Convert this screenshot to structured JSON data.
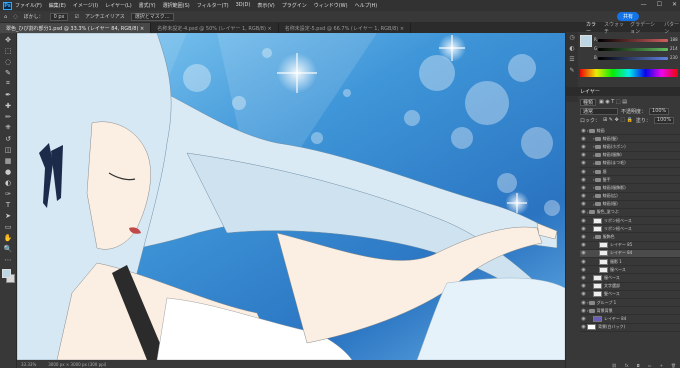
{
  "app": {
    "logo": "Ps",
    "share_label": "共有"
  },
  "menu": [
    "ファイル(F)",
    "編集(E)",
    "イメージ(I)",
    "レイヤー(L)",
    "書式(Y)",
    "選択範囲(S)",
    "フィルター(T)",
    "3D(D)",
    "表示(V)",
    "プラグイン",
    "ウィンドウ(W)",
    "ヘルプ(H)"
  ],
  "window_controls": [
    "—",
    "☐",
    "✕"
  ],
  "options": {
    "blur_label": "ぼかし：",
    "blur_value": "0 px",
    "antialias_label": "アンチエイリアス",
    "select_mask_label": "選択とマスク..."
  },
  "tabs": [
    {
      "label": "翠色_ひび割れ部分1.psd @ 33.3% (レイヤー 84, RGB/8) ×",
      "active": true
    },
    {
      "label": "名称未設定-4.psd @ 50% (レイヤー 1, RGB/8) ×",
      "active": false
    },
    {
      "label": "名称未設定-5.psd @ 66.7% (レイヤー 1, RGB/8) ×",
      "active": false
    }
  ],
  "status": {
    "zoom": "33.33%",
    "doc_size": "3000 px × 3000 px (300 ppi)"
  },
  "color_panel": {
    "tabs": [
      "カラー",
      "スウォッチ",
      "グラデーション",
      "パターン"
    ],
    "sliders": [
      {
        "label": "R",
        "value": "188",
        "color": "#d06060"
      },
      {
        "label": "G",
        "value": "214",
        "color": "#60c060"
      },
      {
        "label": "B",
        "value": "230",
        "color": "#6080e0"
      }
    ],
    "fg_color": "#bcd6e6"
  },
  "layers_panel": {
    "title": "レイヤー",
    "filter": "種類",
    "blend_mode": "通常",
    "opacity_label": "不透明度：",
    "opacity": "100%",
    "lock_label": "ロック：",
    "fill_label": "塗り：",
    "fill": "100%",
    "layers": [
      {
        "name": "線画",
        "kind": "folder",
        "indent": 0
      },
      {
        "name": "線画(髪)",
        "kind": "folder",
        "indent": 1
      },
      {
        "name": "線画(ホボン)",
        "kind": "folder",
        "indent": 1
      },
      {
        "name": "線画(服飾)",
        "kind": "folder",
        "indent": 1
      },
      {
        "name": "線画(まつ毛)",
        "kind": "folder",
        "indent": 1
      },
      {
        "name": "眉",
        "kind": "folder",
        "indent": 1
      },
      {
        "name": "髪手",
        "kind": "folder",
        "indent": 1
      },
      {
        "name": "線画(服飾影)",
        "kind": "folder",
        "indent": 1
      },
      {
        "name": "線画(広)",
        "kind": "folder",
        "indent": 1
      },
      {
        "name": "線画(服)",
        "kind": "folder",
        "indent": 1
      },
      {
        "name": "服色_塗つぶ",
        "kind": "folder",
        "indent": 0
      },
      {
        "name": "リボン紐ベース",
        "kind": "layer",
        "indent": 1
      },
      {
        "name": "リボン紐ベース",
        "kind": "layer",
        "indent": 1
      },
      {
        "name": "服飾色",
        "kind": "folder",
        "indent": 1
      },
      {
        "name": "レイヤー 85",
        "kind": "layer",
        "indent": 2
      },
      {
        "name": "レイヤー 84",
        "kind": "layer",
        "indent": 2,
        "selected": true
      },
      {
        "name": "服影 1",
        "kind": "layer",
        "indent": 2
      },
      {
        "name": "服ベース",
        "kind": "layer",
        "indent": 2
      },
      {
        "name": "服ベース",
        "kind": "layer",
        "indent": 1
      },
      {
        "name": "文字選部",
        "kind": "layer",
        "indent": 1
      },
      {
        "name": "髪ベース",
        "kind": "layer",
        "indent": 1
      },
      {
        "name": "グループ 1",
        "kind": "folder",
        "indent": 0
      },
      {
        "name": "背景背景",
        "kind": "folder",
        "indent": 0
      },
      {
        "name": "レイヤー 84",
        "kind": "layer",
        "indent": 1,
        "thumb": "purple"
      },
      {
        "name": "背景(白バック)",
        "kind": "layer",
        "indent": 0,
        "thumb": "white"
      }
    ]
  },
  "tools": [
    "move",
    "marquee",
    "lasso",
    "quick-select",
    "crop",
    "eyedropper",
    "healing",
    "brush",
    "stamp",
    "history",
    "eraser",
    "gradient",
    "blur",
    "dodge",
    "pen",
    "type",
    "path-select",
    "shape",
    "hand",
    "zoom",
    "more"
  ]
}
